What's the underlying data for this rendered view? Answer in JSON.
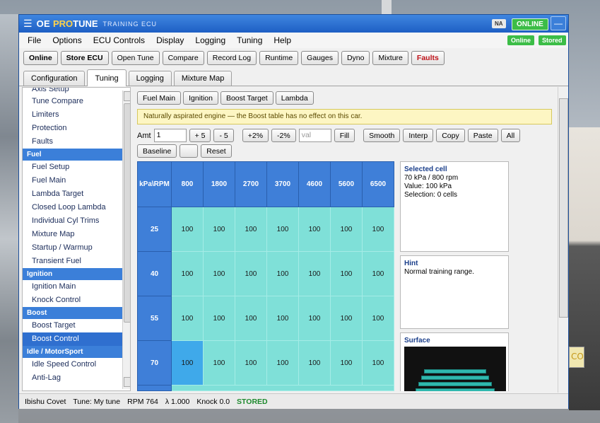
{
  "app": {
    "title_oe": "OE",
    "title_pro": "PRO",
    "title_tune": "TUNE",
    "subtitle": "TRAINING ECU",
    "badge_na": "NA",
    "badge_online": "ONLINE",
    "min_button": "—"
  },
  "menu": [
    "File",
    "Options",
    "ECU Controls",
    "Display",
    "Logging",
    "Tuning",
    "Help"
  ],
  "menu_status": {
    "online": "Online",
    "stored": "Stored"
  },
  "toolbar": [
    "Online",
    "Store ECU",
    "Open Tune",
    "Compare",
    "Record Log",
    "Runtime",
    "Gauges",
    "Dyno",
    "Mixture",
    "Faults"
  ],
  "tabs": [
    "Configuration",
    "Tuning",
    "Logging",
    "Mixture Map"
  ],
  "sidebar": {
    "cut_item": "Axis Setup",
    "group0": [
      "Tune Compare",
      "Limiters",
      "Protection",
      "Faults"
    ],
    "fuel_head": "Fuel",
    "fuel": [
      "Fuel Setup",
      "Fuel Main",
      "Lambda Target",
      "Closed Loop Lambda",
      "Individual Cyl Trims",
      "Mixture Map",
      "Startup / Warmup",
      "Transient Fuel"
    ],
    "ign_head": "Ignition",
    "ign": [
      "Ignition Main",
      "Knock Control"
    ],
    "boost_head": "Boost",
    "boost": [
      "Boost Target",
      "Boost Control"
    ],
    "idle_head": "Idle / MotorSport",
    "idle": [
      "Idle Speed Control",
      "Anti-Lag"
    ]
  },
  "subtabs": [
    "Fuel Main",
    "Ignition",
    "Boost Target",
    "Lambda"
  ],
  "notice": "Naturally aspirated engine — the Boost table has no effect on this car.",
  "controls": {
    "amt_label": "Amt",
    "amt_value": "1",
    "plus5": "+ 5",
    "minus5": "- 5",
    "plus2pct": "+2%",
    "minus2pct": "-2%",
    "val_placeholder": "val",
    "fill": "Fill",
    "smooth": "Smooth",
    "interp": "Interp",
    "copy": "Copy",
    "paste": "Paste",
    "all": "All",
    "baseline": "Baseline",
    "blank": "",
    "reset": "Reset"
  },
  "table": {
    "corner": "kPa\\RPM",
    "rpm": [
      "800",
      "1800",
      "2700",
      "3700",
      "4600",
      "5600",
      "6500"
    ],
    "rows": [
      {
        "kpa": "25",
        "values": [
          "100",
          "100",
          "100",
          "100",
          "100",
          "100",
          "100"
        ]
      },
      {
        "kpa": "40",
        "values": [
          "100",
          "100",
          "100",
          "100",
          "100",
          "100",
          "100"
        ]
      },
      {
        "kpa": "55",
        "values": [
          "100",
          "100",
          "100",
          "100",
          "100",
          "100",
          "100"
        ]
      },
      {
        "kpa": "70",
        "values": [
          "100",
          "100",
          "100",
          "100",
          "100",
          "100",
          "100"
        ]
      }
    ]
  },
  "selected_cell": {
    "title": "Selected cell",
    "line1": "70 kPa / 800 rpm",
    "line2": "Value: 100 kPa",
    "line3": "Selection: 0 cells"
  },
  "hint": {
    "title": "Hint",
    "text": "Normal training range."
  },
  "surface": {
    "title": "Surface"
  },
  "status": {
    "car": "Ibishu Covet",
    "tune": "Tune: My tune",
    "rpm": "RPM 764",
    "lambda": "λ 1.000",
    "knock": "Knock 0.0",
    "stored": "STORED"
  },
  "colors": {
    "titlebar": "#1e5fc4",
    "header_cell": "#3f7fd8",
    "cell": "#7fe0d8",
    "selected_cell": "#3fa9ea",
    "online": "#3cbd47",
    "faults": "#c0141b"
  }
}
